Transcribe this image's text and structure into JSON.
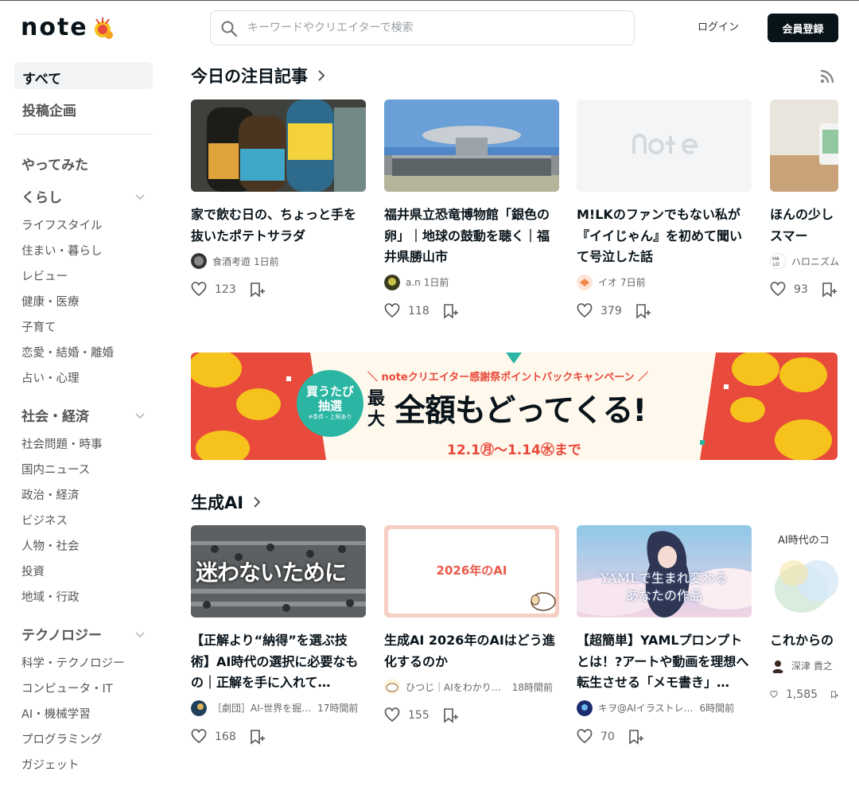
{
  "header": {
    "logo": "note",
    "search_placeholder": "キーワードやクリエイターで検索",
    "login": "ログイン",
    "register": "会員登録"
  },
  "sidebar": {
    "top": [
      {
        "label": "すべて",
        "active": true
      },
      {
        "label": "投稿企画",
        "active": false
      }
    ],
    "groups": [
      {
        "title": "やってみた",
        "items": []
      },
      {
        "title": "くらし",
        "items": [
          "ライフスタイル",
          "住まい・暮らし",
          "レビュー",
          "健康・医療",
          "子育て",
          "恋愛・結婚・離婚",
          "占い・心理"
        ]
      },
      {
        "title": "社会・経済",
        "items": [
          "社会問題・時事",
          "国内ニュース",
          "政治・経済",
          "ビジネス",
          "人物・社会",
          "投資",
          "地域・行政"
        ]
      },
      {
        "title": "テクノロジー",
        "items": [
          "科学・テクノロジー",
          "コンピュータ・IT",
          "AI・機械学習",
          "プログラミング",
          "ガジェット"
        ]
      }
    ]
  },
  "sections": [
    {
      "title": "今日の注目記事",
      "cards": [
        {
          "title": "家で飲む日の、ちょっと手を抜いたポテトサラダ",
          "author": "食酒考遊",
          "time": "1日前",
          "likes": "123"
        },
        {
          "title": "福井県立恐竜博物館「銀色の卵」｜地球の鼓動を聴く｜福井県勝山市",
          "author": "a.n",
          "time": "1日前",
          "likes": "118"
        },
        {
          "title": "M!LKのファンでもない私が『イイじゃん』を初めて聞いて号泣した話",
          "author": "イオ",
          "time": "7日前",
          "likes": "379"
        },
        {
          "title": "ほんの少し Amazon Eめるスマー",
          "author": "ハロニズム",
          "time": "",
          "likes": "93"
        }
      ]
    },
    {
      "title": "生成AI",
      "cards": [
        {
          "title": "【正解より“納得”を選ぶ技術】AI時代の選択に必要なもの｜正解を手に入れて…",
          "author": "［劇団］AI-世界を掘…",
          "time": "17時間前",
          "likes": "168",
          "thumb_text": "迷わないために"
        },
        {
          "title": "生成AI 2026年のAIはどう進化するのか",
          "author": "ひつじ｜AIをわかり…",
          "time": "18時間前",
          "likes": "155",
          "thumb_text": "2026年のAI"
        },
        {
          "title": "【超簡単】YAMLプロンプトとは！?アートや動画を理想へ転生させる「メモ書き」…",
          "author": "キヲ@AIイラストレ…",
          "time": "6時間前",
          "likes": "70",
          "thumb_text_1": "YAMLで生まれ変わる",
          "thumb_text_2": "あなたの作品"
        },
        {
          "title": "これからの どんなコン きか?",
          "author": "深津 貴之",
          "time": "",
          "likes": "1,585",
          "thumb_text": "AI時代のコ"
        }
      ]
    }
  ],
  "banner": {
    "badge_1": "買うたび",
    "badge_2": "抽選",
    "badge_note": "※条件・上限あり",
    "headline_top": "＼ noteクリエイター感謝祭ポイントバックキャンペーン ／",
    "headline_small_1": "最",
    "headline_small_2": "大",
    "headline_main": "全額もどってくる!",
    "dates": "12.1㊊〜1.14㊌まで"
  },
  "colors": {
    "brand_dark": "#08131a",
    "banner_red": "#e84a3b",
    "banner_teal": "#2bb6a4",
    "coin": "#f6c21c"
  }
}
